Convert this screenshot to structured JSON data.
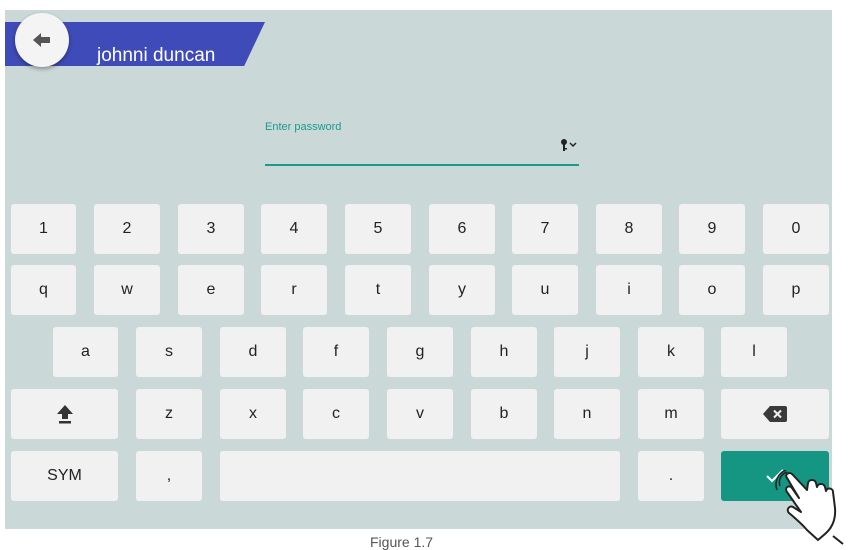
{
  "header": {
    "user_name": "johnni duncan"
  },
  "password": {
    "label": "Enter password"
  },
  "keyboard": {
    "row1": [
      "1",
      "2",
      "3",
      "4",
      "5",
      "6",
      "7",
      "8",
      "9",
      "0"
    ],
    "row2": [
      "q",
      "w",
      "e",
      "r",
      "t",
      "y",
      "u",
      "i",
      "o",
      "p"
    ],
    "row3": [
      "a",
      "s",
      "d",
      "f",
      "g",
      "h",
      "j",
      "k",
      "l"
    ],
    "row4": [
      "z",
      "x",
      "c",
      "v",
      "b",
      "n",
      "m"
    ],
    "sym_label": "SYM",
    "comma_label": ",",
    "period_label": "."
  },
  "caption": "Figure 1.7",
  "colors": {
    "screen_bg": "#cad9d8",
    "header_bar": "#3f4bb8",
    "accent": "#1c9a8a",
    "enter_key": "#159682",
    "key_bg": "#f1f1f1"
  },
  "icons": {
    "back": "arrow-left-icon",
    "password_toggle": "key-icon",
    "shift": "shift-arrow-icon",
    "backspace": "backspace-icon",
    "enter": "checkmark-icon",
    "pointer": "tapping-hand-icon"
  }
}
